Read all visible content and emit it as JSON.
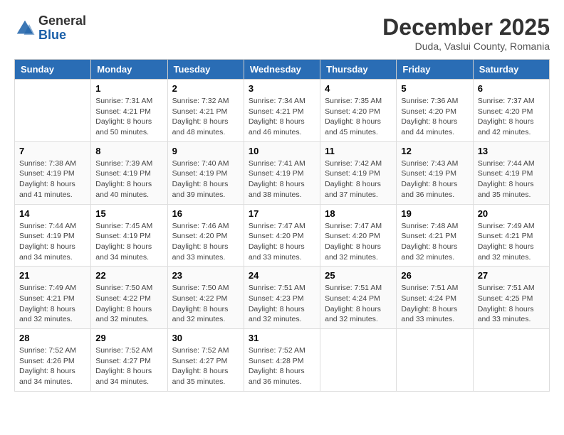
{
  "header": {
    "logo": {
      "general": "General",
      "blue": "Blue"
    },
    "title": "December 2025",
    "location": "Duda, Vaslui County, Romania"
  },
  "weekdays": [
    "Sunday",
    "Monday",
    "Tuesday",
    "Wednesday",
    "Thursday",
    "Friday",
    "Saturday"
  ],
  "weeks": [
    [
      {
        "day": "",
        "info": ""
      },
      {
        "day": "1",
        "info": "Sunrise: 7:31 AM\nSunset: 4:21 PM\nDaylight: 8 hours\nand 50 minutes."
      },
      {
        "day": "2",
        "info": "Sunrise: 7:32 AM\nSunset: 4:21 PM\nDaylight: 8 hours\nand 48 minutes."
      },
      {
        "day": "3",
        "info": "Sunrise: 7:34 AM\nSunset: 4:21 PM\nDaylight: 8 hours\nand 46 minutes."
      },
      {
        "day": "4",
        "info": "Sunrise: 7:35 AM\nSunset: 4:20 PM\nDaylight: 8 hours\nand 45 minutes."
      },
      {
        "day": "5",
        "info": "Sunrise: 7:36 AM\nSunset: 4:20 PM\nDaylight: 8 hours\nand 44 minutes."
      },
      {
        "day": "6",
        "info": "Sunrise: 7:37 AM\nSunset: 4:20 PM\nDaylight: 8 hours\nand 42 minutes."
      }
    ],
    [
      {
        "day": "7",
        "info": "Sunrise: 7:38 AM\nSunset: 4:19 PM\nDaylight: 8 hours\nand 41 minutes."
      },
      {
        "day": "8",
        "info": "Sunrise: 7:39 AM\nSunset: 4:19 PM\nDaylight: 8 hours\nand 40 minutes."
      },
      {
        "day": "9",
        "info": "Sunrise: 7:40 AM\nSunset: 4:19 PM\nDaylight: 8 hours\nand 39 minutes."
      },
      {
        "day": "10",
        "info": "Sunrise: 7:41 AM\nSunset: 4:19 PM\nDaylight: 8 hours\nand 38 minutes."
      },
      {
        "day": "11",
        "info": "Sunrise: 7:42 AM\nSunset: 4:19 PM\nDaylight: 8 hours\nand 37 minutes."
      },
      {
        "day": "12",
        "info": "Sunrise: 7:43 AM\nSunset: 4:19 PM\nDaylight: 8 hours\nand 36 minutes."
      },
      {
        "day": "13",
        "info": "Sunrise: 7:44 AM\nSunset: 4:19 PM\nDaylight: 8 hours\nand 35 minutes."
      }
    ],
    [
      {
        "day": "14",
        "info": "Sunrise: 7:44 AM\nSunset: 4:19 PM\nDaylight: 8 hours\nand 34 minutes."
      },
      {
        "day": "15",
        "info": "Sunrise: 7:45 AM\nSunset: 4:19 PM\nDaylight: 8 hours\nand 34 minutes."
      },
      {
        "day": "16",
        "info": "Sunrise: 7:46 AM\nSunset: 4:20 PM\nDaylight: 8 hours\nand 33 minutes."
      },
      {
        "day": "17",
        "info": "Sunrise: 7:47 AM\nSunset: 4:20 PM\nDaylight: 8 hours\nand 33 minutes."
      },
      {
        "day": "18",
        "info": "Sunrise: 7:47 AM\nSunset: 4:20 PM\nDaylight: 8 hours\nand 32 minutes."
      },
      {
        "day": "19",
        "info": "Sunrise: 7:48 AM\nSunset: 4:21 PM\nDaylight: 8 hours\nand 32 minutes."
      },
      {
        "day": "20",
        "info": "Sunrise: 7:49 AM\nSunset: 4:21 PM\nDaylight: 8 hours\nand 32 minutes."
      }
    ],
    [
      {
        "day": "21",
        "info": "Sunrise: 7:49 AM\nSunset: 4:21 PM\nDaylight: 8 hours\nand 32 minutes."
      },
      {
        "day": "22",
        "info": "Sunrise: 7:50 AM\nSunset: 4:22 PM\nDaylight: 8 hours\nand 32 minutes."
      },
      {
        "day": "23",
        "info": "Sunrise: 7:50 AM\nSunset: 4:22 PM\nDaylight: 8 hours\nand 32 minutes."
      },
      {
        "day": "24",
        "info": "Sunrise: 7:51 AM\nSunset: 4:23 PM\nDaylight: 8 hours\nand 32 minutes."
      },
      {
        "day": "25",
        "info": "Sunrise: 7:51 AM\nSunset: 4:24 PM\nDaylight: 8 hours\nand 32 minutes."
      },
      {
        "day": "26",
        "info": "Sunrise: 7:51 AM\nSunset: 4:24 PM\nDaylight: 8 hours\nand 33 minutes."
      },
      {
        "day": "27",
        "info": "Sunrise: 7:51 AM\nSunset: 4:25 PM\nDaylight: 8 hours\nand 33 minutes."
      }
    ],
    [
      {
        "day": "28",
        "info": "Sunrise: 7:52 AM\nSunset: 4:26 PM\nDaylight: 8 hours\nand 34 minutes."
      },
      {
        "day": "29",
        "info": "Sunrise: 7:52 AM\nSunset: 4:27 PM\nDaylight: 8 hours\nand 34 minutes."
      },
      {
        "day": "30",
        "info": "Sunrise: 7:52 AM\nSunset: 4:27 PM\nDaylight: 8 hours\nand 35 minutes."
      },
      {
        "day": "31",
        "info": "Sunrise: 7:52 AM\nSunset: 4:28 PM\nDaylight: 8 hours\nand 36 minutes."
      },
      {
        "day": "",
        "info": ""
      },
      {
        "day": "",
        "info": ""
      },
      {
        "day": "",
        "info": ""
      }
    ]
  ]
}
